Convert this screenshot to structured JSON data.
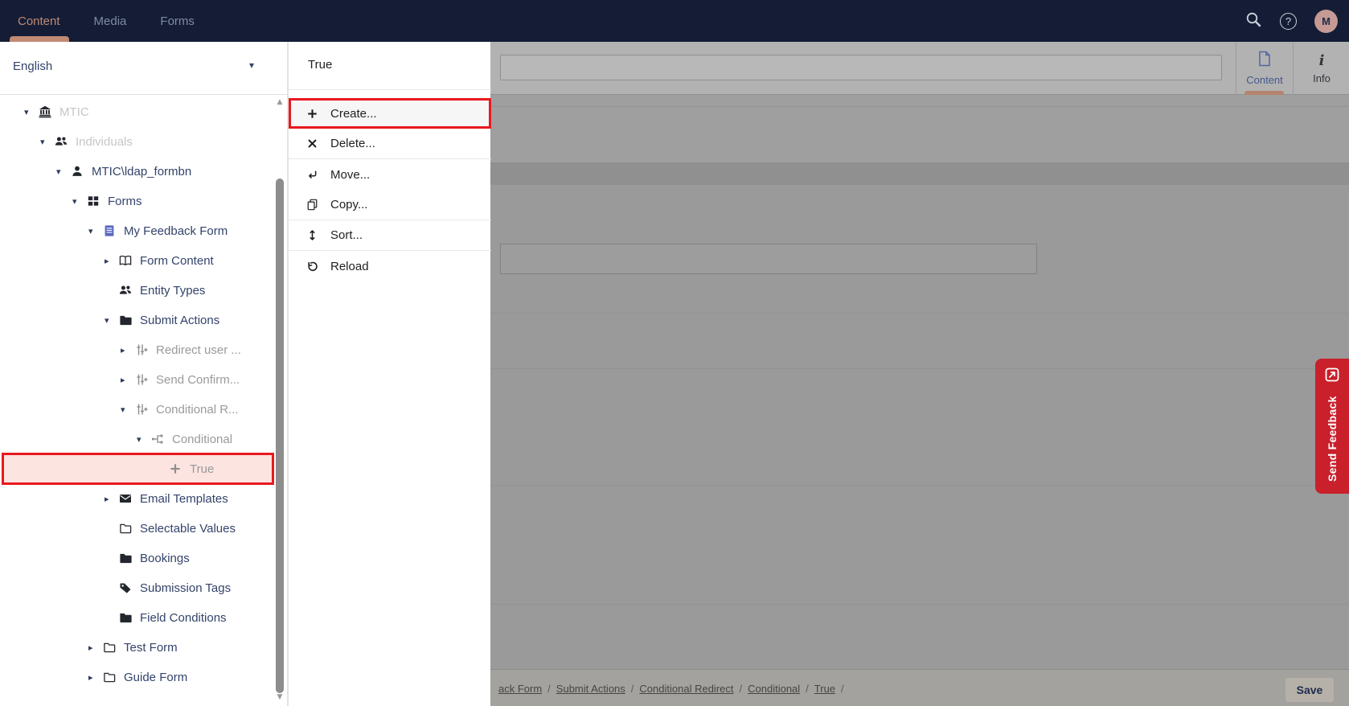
{
  "topnav": {
    "tabs": [
      {
        "label": "Content",
        "active": true
      },
      {
        "label": "Media",
        "active": false
      },
      {
        "label": "Forms",
        "active": false
      }
    ],
    "avatar_letter": "M"
  },
  "language": {
    "value": "English"
  },
  "tree": {
    "items": [
      {
        "label": "MTIC",
        "icon": "bank",
        "level": 0,
        "caret": "down",
        "state": "disabled"
      },
      {
        "label": "Individuals",
        "icon": "users",
        "level": 1,
        "caret": "down",
        "state": "disabled"
      },
      {
        "label": "MTIC\\ldap_formbn",
        "icon": "user",
        "level": 2,
        "caret": "down",
        "state": "normal"
      },
      {
        "label": "Forms",
        "icon": "grid",
        "level": 3,
        "caret": "down",
        "state": "normal"
      },
      {
        "label": "My Feedback Form",
        "icon": "doc",
        "level": 4,
        "caret": "down",
        "state": "normal",
        "icon_color": "blue"
      },
      {
        "label": "Form Content",
        "icon": "book",
        "level": 5,
        "caret": "right",
        "state": "normal"
      },
      {
        "label": "Entity Types",
        "icon": "users",
        "level": 5,
        "caret": "none",
        "state": "normal"
      },
      {
        "label": "Submit Actions",
        "icon": "folder",
        "level": 5,
        "caret": "down",
        "state": "normal"
      },
      {
        "label": "Redirect user ...",
        "icon": "sliders",
        "level": 6,
        "caret": "right",
        "state": "muted"
      },
      {
        "label": "Send Confirm...",
        "icon": "sliders",
        "level": 6,
        "caret": "right",
        "state": "muted"
      },
      {
        "label": "Conditional R...",
        "icon": "sliders",
        "level": 6,
        "caret": "down",
        "state": "muted"
      },
      {
        "label": "Conditional",
        "icon": "branch",
        "level": 7,
        "caret": "down",
        "state": "muted"
      },
      {
        "label": "True",
        "icon": "plus",
        "level": 8,
        "caret": "none",
        "state": "muted",
        "selected": true
      },
      {
        "label": "Email Templates",
        "icon": "envelope",
        "level": 5,
        "caret": "right",
        "state": "normal"
      },
      {
        "label": "Selectable Values",
        "icon": "folder-outline",
        "level": 5,
        "caret": "none",
        "state": "normal"
      },
      {
        "label": "Bookings",
        "icon": "folder",
        "level": 5,
        "caret": "none",
        "state": "normal"
      },
      {
        "label": "Submission Tags",
        "icon": "tag",
        "level": 5,
        "caret": "none",
        "state": "normal"
      },
      {
        "label": "Field Conditions",
        "icon": "folder",
        "level": 5,
        "caret": "none",
        "state": "normal"
      },
      {
        "label": "Test Form",
        "icon": "folder-outline",
        "level": 4,
        "caret": "right",
        "state": "normal"
      },
      {
        "label": "Guide Form",
        "icon": "folder-outline",
        "level": 4,
        "caret": "right",
        "state": "normal"
      }
    ]
  },
  "context_menu": {
    "title": "True",
    "items": [
      {
        "label": "Create...",
        "icon": "plus",
        "highlighted": true
      },
      {
        "label": "Delete...",
        "icon": "cross",
        "divider_after": true
      },
      {
        "label": "Move...",
        "icon": "move"
      },
      {
        "label": "Copy...",
        "icon": "copy",
        "divider_after": true
      },
      {
        "label": "Sort...",
        "icon": "sort",
        "divider_after": true
      },
      {
        "label": "Reload",
        "icon": "reload"
      }
    ]
  },
  "main": {
    "tabs": [
      {
        "label": "Content",
        "icon": "document-icon",
        "active": true
      },
      {
        "label": "Info",
        "icon": "info-icon",
        "active": false
      }
    ]
  },
  "footer": {
    "breadcrumb": [
      "ack Form",
      "Submit Actions",
      "Conditional Redirect",
      "Conditional",
      "True"
    ],
    "separator": "/",
    "save_label": "Save"
  },
  "feedback": {
    "label": "Send Feedback"
  },
  "colors": {
    "topnav_bg": "#141d35",
    "nav_active": "#c08a74",
    "navy_text": "#33436a",
    "highlight_border_red": "#e8191f",
    "selection_pink": "#fce4e1",
    "feedback_red": "#c9202c",
    "avatar_bg": "#c59a94",
    "doc_icon_blue": "#5a68c0"
  }
}
